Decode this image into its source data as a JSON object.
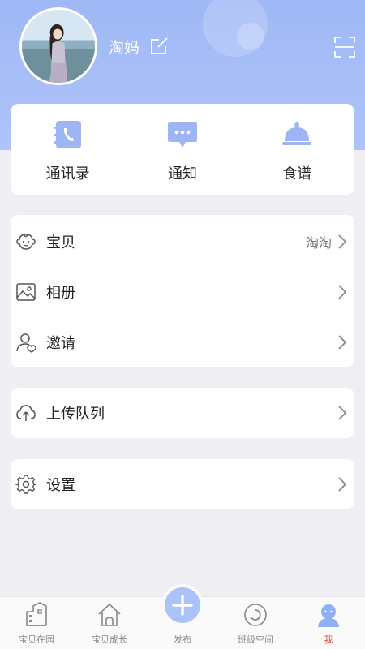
{
  "header": {
    "username": "淘妈"
  },
  "quick_actions": [
    {
      "label": "通讯录",
      "icon": "contacts-book-icon"
    },
    {
      "label": "通知",
      "icon": "chat-bubble-icon"
    },
    {
      "label": "食谱",
      "icon": "food-cloche-icon"
    }
  ],
  "menu": {
    "baby": {
      "label": "宝贝",
      "value": "淘淘",
      "icon": "baby-face-icon"
    },
    "album": {
      "label": "相册",
      "icon": "photo-icon"
    },
    "invite": {
      "label": "邀请",
      "icon": "invite-user-icon"
    },
    "upload": {
      "label": "上传队列",
      "icon": "cloud-upload-icon"
    },
    "settings": {
      "label": "设置",
      "icon": "gear-icon"
    }
  },
  "tabbar": [
    {
      "label": "宝贝在园",
      "icon": "school-building-icon"
    },
    {
      "label": "宝贝成长",
      "icon": "home-icon"
    },
    {
      "label": "发布",
      "icon": "plus-icon"
    },
    {
      "label": "班级空间",
      "icon": "class-circle-icon"
    },
    {
      "label": "我",
      "icon": "profile-icon"
    }
  ],
  "colors": {
    "accent": "#a9c2f7",
    "header_bg": "#9fb8f6",
    "active_tab": "#e0463a",
    "page_bg": "#eeeef3"
  }
}
